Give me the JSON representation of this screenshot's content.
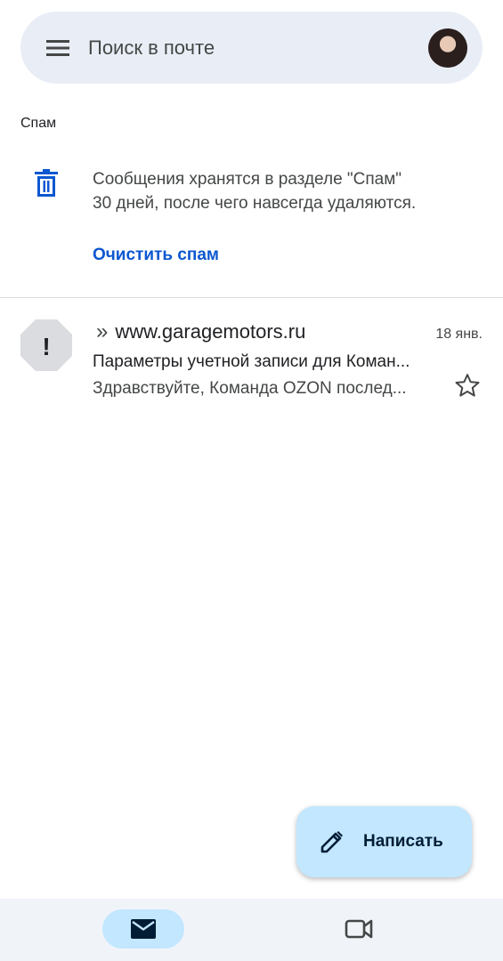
{
  "search": {
    "placeholder": "Поиск в почте",
    "menu_icon": "hamburger-menu-icon",
    "avatar": "account-avatar"
  },
  "folder": {
    "title": "Спам"
  },
  "spam_info": {
    "icon": "trash-icon",
    "line1": "Сообщения хранятся в разделе \"Спам\"",
    "line2": "30 дней, после чего навсегда удаляются.",
    "action_label": "Очистить спам"
  },
  "messages": [
    {
      "avatar_icon": "spam-warning-icon",
      "avatar_glyph": "!",
      "importance_marker": "»",
      "sender": "www.garagemotors.ru",
      "date": "18 янв.",
      "subject": "Параметры учетной записи для Коман...",
      "snippet": "Здравствуйте, Команда OZON послед...",
      "starred": false
    }
  ],
  "compose": {
    "label": "Написать",
    "icon": "pencil-icon"
  },
  "bottom_nav": {
    "items": [
      {
        "icon": "mail-icon",
        "active": true
      },
      {
        "icon": "video-camera-icon",
        "active": false
      }
    ]
  },
  "colors": {
    "accent": "#0b57d0",
    "search_bg": "#e9eef6",
    "fab_bg": "#c2e7ff",
    "nav_bg": "#f0f4f9",
    "spam_icon_bg": "#dadce0"
  }
}
